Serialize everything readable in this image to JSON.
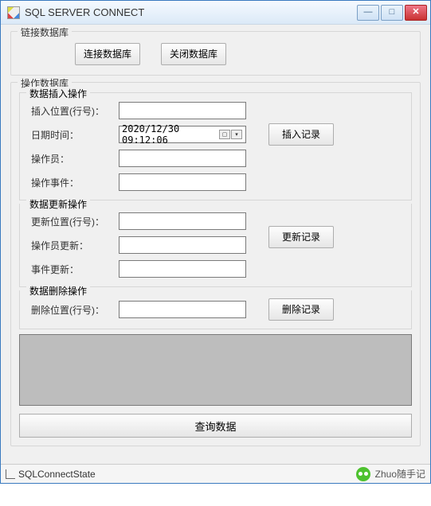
{
  "window": {
    "title": "SQL SERVER CONNECT"
  },
  "groups": {
    "connect": {
      "legend": "链接数据库"
    },
    "operate": {
      "legend": "操作数据库"
    },
    "insert": {
      "legend": "数据插入操作"
    },
    "update": {
      "legend": "数据更新操作"
    },
    "delete": {
      "legend": "数据删除操作"
    }
  },
  "buttons": {
    "connect_db": "连接数据库",
    "close_db": "关闭数据库",
    "insert_record": "插入记录",
    "update_record": "更新记录",
    "delete_record": "删除记录",
    "query_data": "查询数据"
  },
  "labels": {
    "insert_pos": "插入位置(行号)：",
    "datetime": "日期时间：",
    "operator": "操作员：",
    "event": "操作事件：",
    "update_pos": "更新位置(行号)：",
    "operator_update": "操作员更新：",
    "event_update": "事件更新：",
    "delete_pos": "删除位置(行号)："
  },
  "values": {
    "insert_pos": "",
    "datetime": "2020/12/30 09:12:06",
    "operator": "",
    "event": "",
    "update_pos": "",
    "operator_update": "",
    "event_update": "",
    "delete_pos": ""
  },
  "status": {
    "label": "SQLConnectState"
  },
  "watermark": {
    "text": "Zhuo随手记"
  }
}
